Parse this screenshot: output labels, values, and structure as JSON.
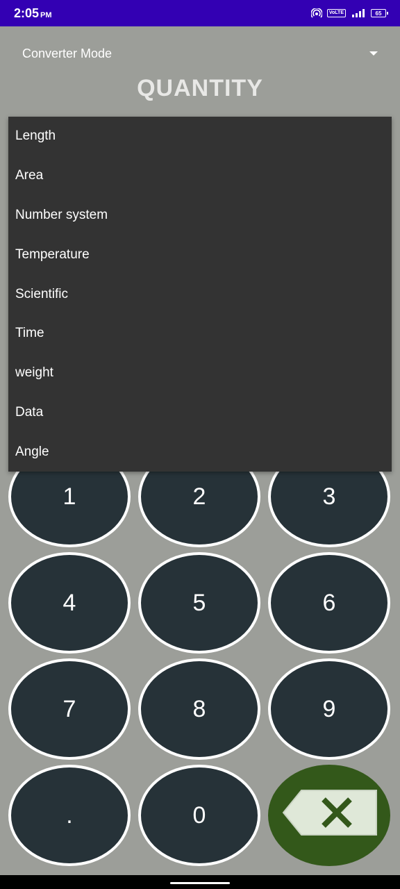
{
  "status_bar": {
    "time": "2:05",
    "ampm": "PM",
    "volte": "VoLTE",
    "battery": "65",
    "icons": [
      "hotspot-icon",
      "volte-icon",
      "signal-icon",
      "battery-icon"
    ]
  },
  "header": {
    "spinner_label": "Converter Mode",
    "title": "QUANTITY"
  },
  "dropdown": {
    "items": [
      "Length",
      "Area",
      "Number system",
      "Temperature",
      "Scientific",
      "Time",
      "weight",
      "Data",
      "Angle"
    ]
  },
  "keypad": {
    "keys": [
      "1",
      "2",
      "3",
      "4",
      "5",
      "6",
      "7",
      "8",
      "9",
      ".",
      "0"
    ],
    "backspace_icon": "backspace-icon"
  },
  "colors": {
    "status_bar": "#3300b3",
    "background": "#9c9e99",
    "key_fill": "#263238",
    "backspace_fill": "#33581a",
    "menu_bg": "#333333"
  }
}
